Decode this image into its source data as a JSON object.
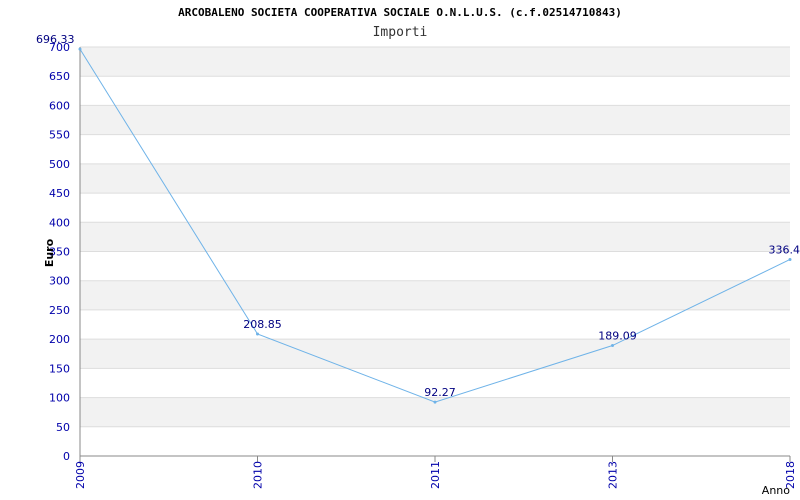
{
  "chart_data": {
    "type": "line",
    "title": "ARCOBALENO SOCIETA COOPERATIVA SOCIALE O.N.L.U.S. (c.f.02514710843)",
    "subtitle": "Importi",
    "xlabel": "Anno",
    "ylabel": "Euro",
    "categories": [
      "2009",
      "2010",
      "2011",
      "2013",
      "2018"
    ],
    "series": [
      {
        "values": [
          696.33,
          208.85,
          92.27,
          189.09,
          336.4
        ]
      }
    ],
    "data_labels": [
      "696.33",
      "208.85",
      "92.27",
      "189.09",
      "336.4"
    ],
    "ylim": [
      0,
      700
    ],
    "yticks": [
      0,
      50,
      100,
      150,
      200,
      250,
      300,
      350,
      400,
      450,
      500,
      550,
      600,
      650,
      700
    ],
    "grid": true,
    "colors": {
      "line": "#6fb3e8",
      "band_fill": "#f2f2f2",
      "axis_text": "#0000aa",
      "data_label": "#000080"
    }
  }
}
